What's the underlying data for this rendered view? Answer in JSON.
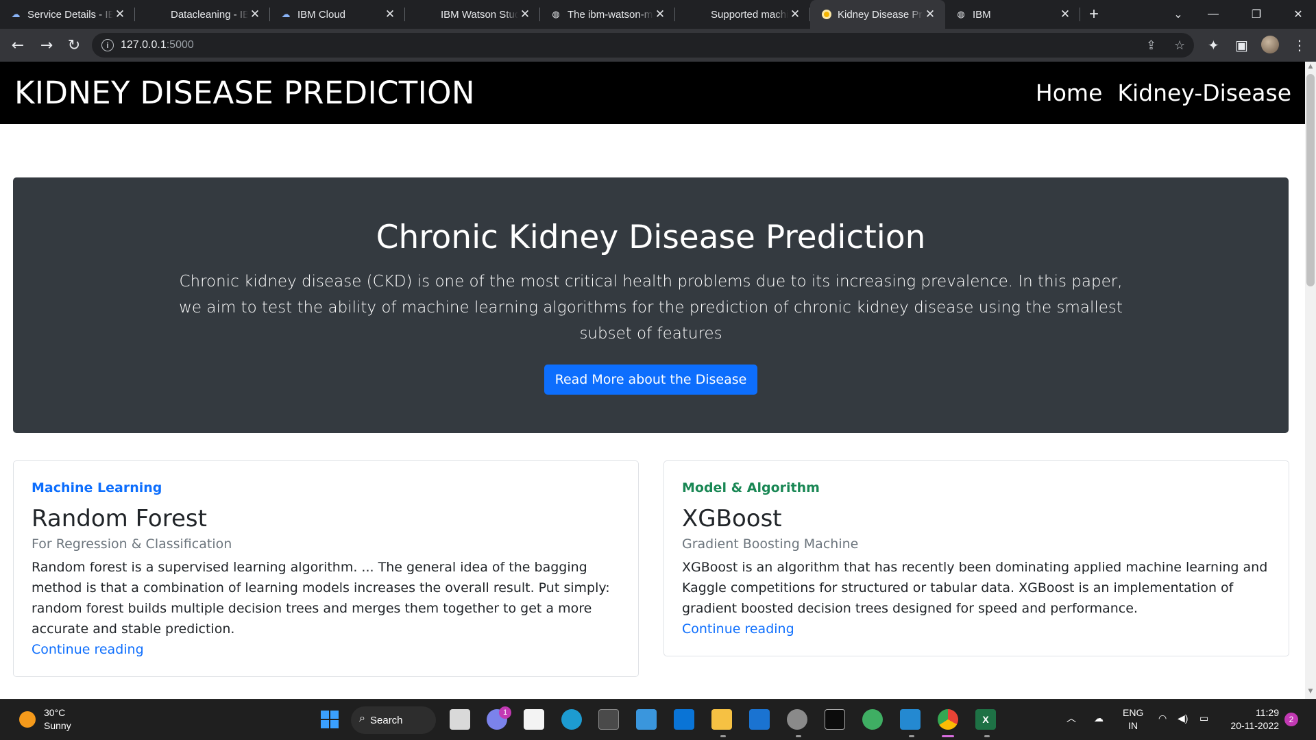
{
  "browser": {
    "tabs": [
      {
        "title": "Service Details - IBM",
        "icon": "ibm-cloud-icon"
      },
      {
        "title": "Datacleaning - IBM",
        "icon": "none"
      },
      {
        "title": "IBM Cloud",
        "icon": "ibm-cloud-icon"
      },
      {
        "title": "IBM Watson Studio",
        "icon": "none"
      },
      {
        "title": "The ibm-watson-machine",
        "icon": "globe-icon"
      },
      {
        "title": "Supported machine",
        "icon": "none"
      },
      {
        "title": "Kidney Disease Prediction",
        "icon": "kidney-favicon",
        "active": true
      },
      {
        "title": "IBM",
        "icon": "globe-icon"
      }
    ],
    "new_tab": "+",
    "close_glyph": "✕",
    "url_host": "127.0.0.1",
    "url_port": ":5000"
  },
  "site": {
    "brand": "KIDNEY DISEASE PREDICTION",
    "nav": [
      "Home",
      "Kidney-Disease"
    ]
  },
  "hero": {
    "title": "Chronic Kidney Disease Prediction",
    "text": "Chronic kidney disease (CKD) is one of the most critical health problems due to its increasing prevalence. In this paper, we aim to test the ability of machine learning algorithms for the prediction of chronic kidney disease using the smallest subset of features",
    "button": "Read More about the Disease"
  },
  "cards": [
    {
      "category": "Machine Learning",
      "category_color": "#0d6efd",
      "title": "Random Forest",
      "subtitle": "For Regression & Classification",
      "body": "Random forest is a supervised learning algorithm. ... The general idea of the bagging method is that a combination of learning models increases the overall result. Put simply: random forest builds multiple decision trees and merges them together to get a more accurate and stable prediction.",
      "link": "Continue reading"
    },
    {
      "category": "Model & Algorithm",
      "category_color": "#198754",
      "title": "XGBoost",
      "subtitle": "Gradient Boosting Machine",
      "body": "XGBoost is an algorithm that has recently been dominating applied machine learning and Kaggle competitions for structured or tabular data. XGBoost is an implementation of gradient boosted decision trees designed for speed and performance.",
      "link": "Continue reading"
    }
  ],
  "taskbar": {
    "weather_temp": "30°C",
    "weather_desc": "Sunny",
    "search_label": "Search",
    "chat_badge": "1",
    "lang_top": "ENG",
    "lang_bottom": "IN",
    "time": "11:29",
    "date": "20-11-2022",
    "notifications": "2"
  }
}
